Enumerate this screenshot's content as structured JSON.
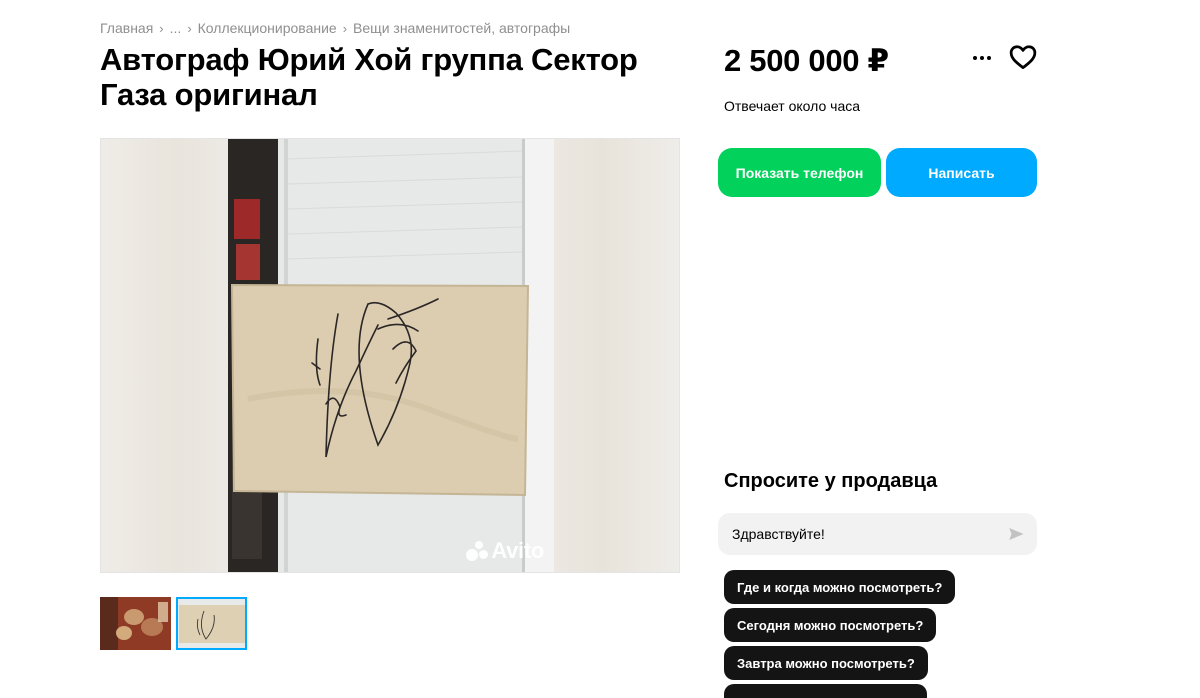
{
  "breadcrumb": {
    "items": [
      "Главная",
      "...",
      "Коллекционирование",
      "Вещи знаменитостей, автографы"
    ],
    "separator": "›"
  },
  "listing": {
    "title": "Автограф Юрий Хой группа Сектор Газа оригинал",
    "price": "2 500 000 ₽",
    "response_time": "Отвечает около часа"
  },
  "actions": {
    "show_phone": "Показать телефон",
    "write": "Написать",
    "more_icon": "more-dots-icon",
    "favorite_icon": "heart-icon"
  },
  "gallery": {
    "watermark": "Avito",
    "thumbnail_count": 2,
    "active_thumbnail": 2
  },
  "ask_seller": {
    "title": "Спросите у продавца",
    "input_value": "Здравствуйте!",
    "send_icon": "send-icon",
    "suggestions": [
      "Где и когда можно посмотреть?",
      "Сегодня можно посмотреть?",
      "Завтра можно посмотреть?"
    ]
  },
  "colors": {
    "phone_button": "#02d15c",
    "write_button": "#00aaff",
    "chip_background": "#141414"
  }
}
